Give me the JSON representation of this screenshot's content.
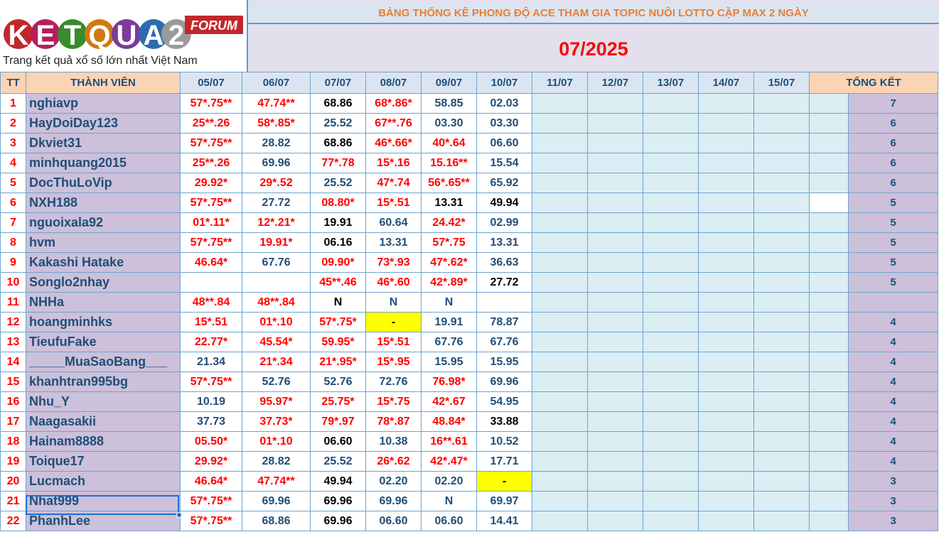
{
  "logo": {
    "brand": "KETQUA2",
    "badge": "FORUM",
    "tagline": "Trang kết quả xổ số lớn nhất Việt Nam"
  },
  "banner": {
    "title": "BẢNG THỐNG KÊ PHONG ĐỘ ACE THAM GIA TOPIC NUÔI LOTTO CẶP MAX 2 NGÀY",
    "month": "07/2025"
  },
  "headers": {
    "tt": "TT",
    "member": "THÀNH VIÊN",
    "dates": [
      "05/07",
      "06/07",
      "07/07",
      "08/07",
      "09/07",
      "10/07",
      "11/07",
      "12/07",
      "13/07",
      "14/07",
      "15/07"
    ],
    "total": "TỔNG KẾT"
  },
  "colors": {
    "red": "#ff0000",
    "blue": "#1f4e79",
    "lavender": "#ccc0da",
    "lightblue": "#daeef3",
    "yellow": "#ffff00",
    "orange": "#ed7d31"
  },
  "rows": [
    {
      "tt": "1",
      "name": "nghiavp",
      "cells": [
        [
          "57*.75**",
          "r"
        ],
        [
          "47.74**",
          "r"
        ],
        [
          "68.86",
          "k"
        ],
        [
          "68*.86*",
          "r"
        ],
        [
          "58.85",
          "b"
        ],
        [
          "02.03",
          "b"
        ]
      ],
      "total": "7"
    },
    {
      "tt": "2",
      "name": "HayDoiDay123",
      "cells": [
        [
          "25**.26",
          "r"
        ],
        [
          "58*.85*",
          "r"
        ],
        [
          "25.52",
          "b"
        ],
        [
          "67**.76",
          "r"
        ],
        [
          "03.30",
          "b"
        ],
        [
          "03.30",
          "b"
        ]
      ],
      "total": "6"
    },
    {
      "tt": "3",
      "name": "Dkviet31",
      "cells": [
        [
          "57*.75**",
          "r"
        ],
        [
          "28.82",
          "b"
        ],
        [
          "68.86",
          "k"
        ],
        [
          "46*.66*",
          "r"
        ],
        [
          "40*.64",
          "r"
        ],
        [
          "06.60",
          "b"
        ]
      ],
      "total": "6"
    },
    {
      "tt": "4",
      "name": "minhquang2015",
      "cells": [
        [
          "25**.26",
          "r"
        ],
        [
          "69.96",
          "b"
        ],
        [
          "77*.78",
          "r"
        ],
        [
          "15*.16",
          "r"
        ],
        [
          "15.16**",
          "r"
        ],
        [
          "15.54",
          "b"
        ]
      ],
      "total": "6"
    },
    {
      "tt": "5",
      "name": "DocThuLoVip",
      "cells": [
        [
          "29.92*",
          "r"
        ],
        [
          "29*.52",
          "r"
        ],
        [
          "25.52",
          "b"
        ],
        [
          "47*.74",
          "r"
        ],
        [
          "56*.65**",
          "r"
        ],
        [
          "65.92",
          "b"
        ]
      ],
      "total": "6"
    },
    {
      "tt": "6",
      "name": "NXH188",
      "cells": [
        [
          "57*.75**",
          "r"
        ],
        [
          "27.72",
          "b"
        ],
        [
          "08.80*",
          "r"
        ],
        [
          "15*.51",
          "r"
        ],
        [
          "13.31",
          "k"
        ],
        [
          "49.94",
          "k"
        ]
      ],
      "total": "5"
    },
    {
      "tt": "7",
      "name": "nguoixala92",
      "cells": [
        [
          "01*.11*",
          "r"
        ],
        [
          "12*.21*",
          "r"
        ],
        [
          "19.91",
          "k"
        ],
        [
          "60.64",
          "b"
        ],
        [
          "24.42*",
          "r"
        ],
        [
          "02.99",
          "b"
        ]
      ],
      "total": "5"
    },
    {
      "tt": "8",
      "name": "hvm",
      "cells": [
        [
          "57*.75**",
          "r"
        ],
        [
          "19.91*",
          "r"
        ],
        [
          "06.16",
          "k"
        ],
        [
          "13.31",
          "b"
        ],
        [
          "57*.75",
          "r"
        ],
        [
          "13.31",
          "b"
        ]
      ],
      "total": "5"
    },
    {
      "tt": "9",
      "name": "Kakashi Hatake",
      "cells": [
        [
          "46.64*",
          "r"
        ],
        [
          "67.76",
          "b"
        ],
        [
          "09.90*",
          "r"
        ],
        [
          "73*.93",
          "r"
        ],
        [
          "47*.62*",
          "r"
        ],
        [
          "36.63",
          "b"
        ]
      ],
      "total": "5"
    },
    {
      "tt": "10",
      "name": "Songlo2nhay",
      "cells": [
        [
          "",
          "w"
        ],
        [
          "",
          "w"
        ],
        [
          "45**.46",
          "r"
        ],
        [
          "46*.60",
          "r"
        ],
        [
          "42*.89*",
          "rn"
        ],
        [
          "27.72",
          "kn"
        ]
      ],
      "total": "5"
    },
    {
      "tt": "11",
      "name": "NHHa",
      "cells": [
        [
          "48**.84",
          "r"
        ],
        [
          "48**.84",
          "r"
        ],
        [
          "N",
          "k"
        ],
        [
          "N",
          "b"
        ],
        [
          "N",
          "b"
        ],
        [
          "",
          "w"
        ]
      ],
      "total": ""
    },
    {
      "tt": "12",
      "name": "hoangminhks",
      "cells": [
        [
          "15*.51",
          "r"
        ],
        [
          "01*.10",
          "r"
        ],
        [
          "57*.75*",
          "r"
        ],
        [
          "-",
          "y"
        ],
        [
          "19.91",
          "b"
        ],
        [
          "78.87",
          "b"
        ]
      ],
      "total": "4"
    },
    {
      "tt": "13",
      "name": "TieufuFake",
      "cells": [
        [
          "22.77*",
          "r"
        ],
        [
          "45.54*",
          "r"
        ],
        [
          "59.95*",
          "r"
        ],
        [
          "15*.51",
          "r"
        ],
        [
          "67.76",
          "b"
        ],
        [
          "67.76",
          "b"
        ]
      ],
      "total": "4"
    },
    {
      "tt": "14",
      "name": "_____MuaSaoBang___",
      "cells": [
        [
          "21.34",
          "b"
        ],
        [
          "21*.34",
          "r"
        ],
        [
          "21*.95*",
          "r"
        ],
        [
          "15*.95",
          "r"
        ],
        [
          "15.95",
          "b"
        ],
        [
          "15.95",
          "b"
        ]
      ],
      "total": "4"
    },
    {
      "tt": "15",
      "name": "khanhtran995bg",
      "cells": [
        [
          "57*.75**",
          "r"
        ],
        [
          "52.76",
          "b"
        ],
        [
          "52.76",
          "b"
        ],
        [
          "72.76",
          "b"
        ],
        [
          "76.98*",
          "r"
        ],
        [
          "69.96",
          "b"
        ]
      ],
      "total": "4"
    },
    {
      "tt": "16",
      "name": "Nhu_Y",
      "cells": [
        [
          "10.19",
          "b"
        ],
        [
          "95.97*",
          "r"
        ],
        [
          "25.75*",
          "r"
        ],
        [
          "15*.75",
          "r"
        ],
        [
          "42*.67",
          "r"
        ],
        [
          "54.95",
          "b"
        ]
      ],
      "total": "4"
    },
    {
      "tt": "17",
      "name": "Naagasakii",
      "cells": [
        [
          "37.73",
          "b"
        ],
        [
          "37.73*",
          "r"
        ],
        [
          "79*.97",
          "r"
        ],
        [
          "78*.87",
          "r"
        ],
        [
          "48.84*",
          "r"
        ],
        [
          "33.88",
          "k"
        ]
      ],
      "total": "4"
    },
    {
      "tt": "18",
      "name": "Hainam8888",
      "cells": [
        [
          "05.50*",
          "r"
        ],
        [
          "01*.10",
          "r"
        ],
        [
          "06.60",
          "k"
        ],
        [
          "10.38",
          "b"
        ],
        [
          "16**.61",
          "r"
        ],
        [
          "10.52",
          "b"
        ]
      ],
      "total": "4"
    },
    {
      "tt": "19",
      "name": "Toique17",
      "cells": [
        [
          "29.92*",
          "r"
        ],
        [
          "28.82",
          "b"
        ],
        [
          "25.52",
          "b"
        ],
        [
          "26*.62",
          "r"
        ],
        [
          "42*.47*",
          "r"
        ],
        [
          "17.71",
          "b"
        ]
      ],
      "total": "4"
    },
    {
      "tt": "20",
      "name": "Lucmach",
      "cells": [
        [
          "46.64*",
          "r"
        ],
        [
          "47.74**",
          "r"
        ],
        [
          "49.94",
          "k"
        ],
        [
          "02.20",
          "b"
        ],
        [
          "02.20",
          "b"
        ],
        [
          "-",
          "y"
        ]
      ],
      "total": "3"
    },
    {
      "tt": "21",
      "name": "Nhat999",
      "cells": [
        [
          "57*.75**",
          "r"
        ],
        [
          "69.96",
          "b"
        ],
        [
          "69.96",
          "k"
        ],
        [
          "69.96",
          "b"
        ],
        [
          "N",
          "b"
        ],
        [
          "69.97",
          "b"
        ]
      ],
      "total": "3"
    },
    {
      "tt": "22",
      "name": "PhanhLee",
      "cells": [
        [
          "57*.75**",
          "r"
        ],
        [
          "68.86",
          "b"
        ],
        [
          "69.96",
          "k"
        ],
        [
          "06.60",
          "b"
        ],
        [
          "06.60",
          "b"
        ],
        [
          "14.41",
          "b"
        ]
      ],
      "total": "3"
    }
  ]
}
